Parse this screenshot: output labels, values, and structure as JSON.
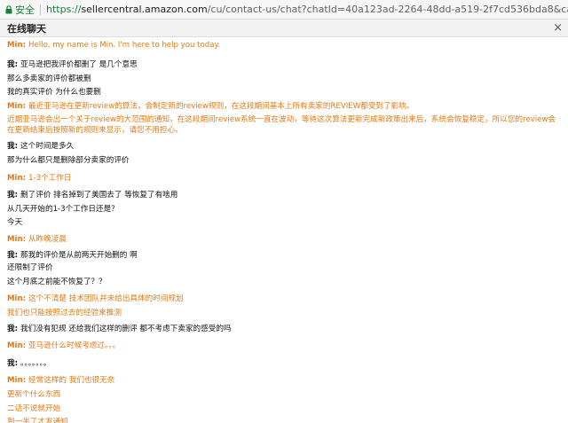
{
  "browser": {
    "secure_label": "安全",
    "url_scheme": "https://",
    "url_host": "sellercentral.amazon.com",
    "url_path": "/cu/contact-us/chat?chatId=40a123ad-2264-48dd-a519-2f7cd536bda8&categoryId=30001&typeId=30..."
  },
  "header": {
    "title": "在线聊天",
    "close_label": "×"
  },
  "messages": [
    {
      "speaker": "Min:",
      "text": "Hello, my name is Min. I'm here to help you today.",
      "role": "agent"
    },
    {
      "speaker": "我:",
      "text": "亚马逊把我评价都删了 是几个意思",
      "role": "user"
    },
    {
      "speaker": "",
      "text": "那么多卖家的评价都被删",
      "role": "user"
    },
    {
      "speaker": "",
      "text": "我的真实评价 为什么也要删",
      "role": "user"
    },
    {
      "speaker": "Min:",
      "text": "最近亚马逊在更新review的算法，会制定新的review规则，在这段期间基本上所有卖家的REVIEW都受到了影响。",
      "role": "agent"
    },
    {
      "speaker": "",
      "text": "近期亚马逊会出一个关于review的大范围的通知，在这段期间review系统一直在波动，等待这次算法更新完成新政策出来后，系统会恢复稳定，所以您的review会在更新结束后按照新的规则来显示，请您不用担心。",
      "role": "agent"
    },
    {
      "speaker": "我:",
      "text": "这个时间是多久",
      "role": "user"
    },
    {
      "speaker": "",
      "text": "那为什么都只是删除部分卖家的评价",
      "role": "user"
    },
    {
      "speaker": "Min:",
      "text": "1-3个工作日",
      "role": "agent"
    },
    {
      "speaker": "我:",
      "text": "删了评价 排名掉到了美国去了 等恢复了有啥用",
      "role": "user"
    },
    {
      "speaker": "",
      "text": "从几天开始的1-3个工作日还是？",
      "role": "user"
    },
    {
      "speaker": "",
      "text": "今天",
      "role": "user"
    },
    {
      "speaker": "Min:",
      "text": "从昨晚凌晨",
      "role": "agent"
    },
    {
      "speaker": "我:",
      "text": "那我的评价是从前两天开始删的 啊",
      "role": "user"
    },
    {
      "speaker": "",
      "text": "还限制了评价",
      "role": "user"
    },
    {
      "speaker": "",
      "text": "这个月底之前能不恢复了？？",
      "role": "user"
    },
    {
      "speaker": "Min:",
      "text": "这个不清楚 技术团队并未给出具体的时间规划",
      "role": "agent"
    },
    {
      "speaker": "",
      "text": "我们也只能按照过去的经验来推测",
      "role": "agent"
    },
    {
      "speaker": "我:",
      "text": "我们没有犯规 还给我们这样的删评 都不考虑下卖家的感受的吗",
      "role": "user"
    },
    {
      "speaker": "Min:",
      "text": "亚马逊什么时候考虑过。。。",
      "role": "agent"
    },
    {
      "speaker": "我:",
      "text": "。。。。。。。",
      "role": "user"
    },
    {
      "speaker": "Min:",
      "text": "经常这样的 我们也很无奈",
      "role": "agent"
    },
    {
      "speaker": "",
      "text": "更新个什么东西",
      "role": "agent"
    },
    {
      "speaker": "",
      "text": "二话不说就开始",
      "role": "agent"
    },
    {
      "speaker": "",
      "text": "到一半了才发通知",
      "role": "agent"
    }
  ]
}
